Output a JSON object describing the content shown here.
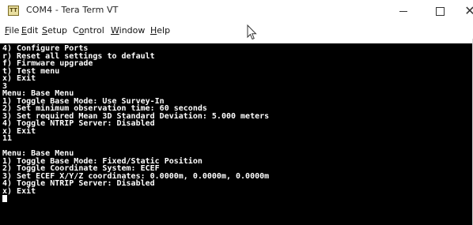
{
  "window": {
    "title": "COM4 - Tera Term VT",
    "app_icon_text": "TT",
    "controls": {
      "minimize_icon": "minimize-icon",
      "maximize_icon": "maximize-icon",
      "close_icon": "close-icon",
      "close_glyph": "✕"
    }
  },
  "menubar": {
    "file": {
      "accel": "F",
      "rest": "ile"
    },
    "edit": {
      "accel": "E",
      "rest": "dit"
    },
    "setup": {
      "accel": "S",
      "rest": "etup"
    },
    "control": {
      "pre": "C",
      "accel": "o",
      "rest": "ntrol"
    },
    "window": {
      "accel": "W",
      "rest": "indow"
    },
    "help": {
      "accel": "H",
      "rest": "elp"
    }
  },
  "terminal": {
    "lines": [
      "4) Configure Ports",
      "r) Reset all settings to default",
      "f) Firmware upgrade",
      "t) Test menu",
      "x) Exit",
      "3",
      "Menu: Base Menu",
      "1) Toggle Base Mode: Use Survey-In",
      "2) Set minimum observation time: 60 seconds",
      "3) Set required Mean 3D Standard Deviation: 5.000 meters",
      "4) Toggle NTRIP Server: Disabled",
      "x) Exit",
      "11",
      "",
      "Menu: Base Menu",
      "1) Toggle Base Mode: Fixed/Static Position",
      "2) Toggle Coordinate System: ECEF",
      "3) Set ECEF X/Y/Z coordinates: 0.0000m, 0.0000m, 0.0000m",
      "4) Toggle NTRIP Server: Disabled",
      "x) Exit"
    ],
    "colors": {
      "background": "#000000",
      "foreground": "#ffffff"
    }
  }
}
